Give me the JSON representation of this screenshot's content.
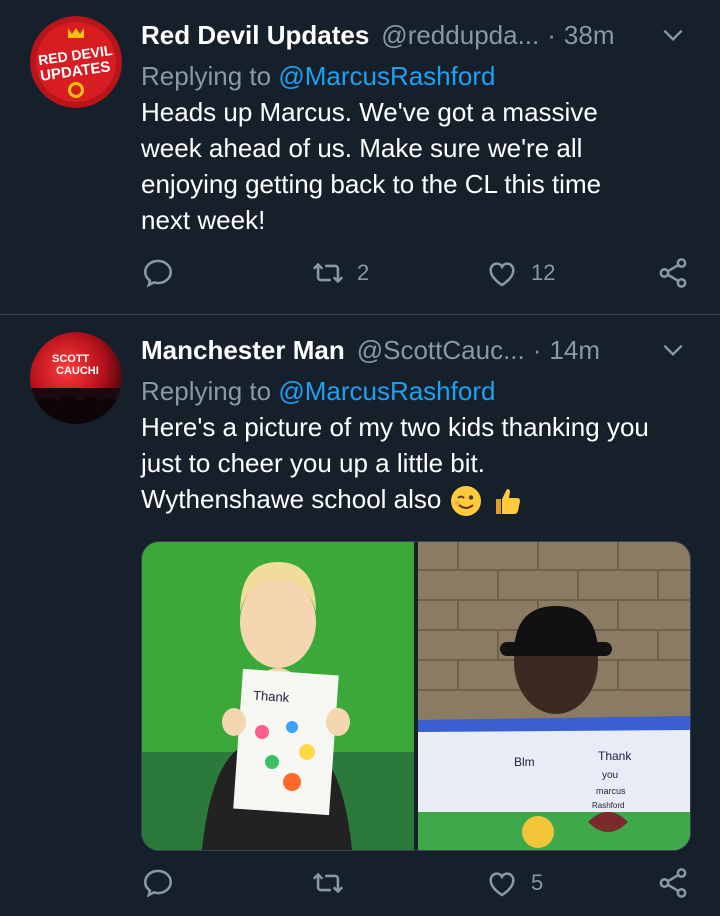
{
  "tweets": [
    {
      "author": {
        "name": "Red Devil Updates",
        "handle": "@reddupda...",
        "avatar_lines": [
          "RED DEVIL",
          "UPDATES"
        ]
      },
      "time": "38m",
      "replying_prefix": "Replying to ",
      "replying_to": "@MarcusRashford",
      "text_lines": [
        "Heads up Marcus. We've got a massive",
        "week ahead of us. Make sure we're all",
        "enjoying getting back to the CL this time",
        "next week!"
      ],
      "stats": {
        "retweets": "2",
        "likes": "12"
      }
    },
    {
      "author": {
        "name": "Manchester Man",
        "handle": "@ScottCauc...",
        "avatar_lines": [
          "SCOTT",
          "CAUCHI"
        ]
      },
      "time": "14m",
      "replying_prefix": "Replying to ",
      "replying_to": "@MarcusRashford",
      "text_lines": [
        "Here's a picture of my two kids thanking you",
        "just to cheer you up a little bit.",
        "Wythenshawe school also"
      ],
      "emojis": [
        "winking-face-emoji",
        "thumbs-up-emoji"
      ],
      "stats": {
        "likes": "5"
      },
      "photos": [
        {
          "card_text": "Thank",
          "icon": "child-holding-card"
        },
        {
          "card_text": [
            "Blm",
            "Thank",
            "you",
            "marcus",
            "Rashford"
          ],
          "icon": "child-holding-banner"
        }
      ]
    }
  ],
  "colors": {
    "background": "#15202b",
    "secondary_text": "#8899a6",
    "link": "#1da1f2",
    "divider": "#38444d"
  },
  "icons": [
    "reply-icon",
    "retweet-icon",
    "like-icon",
    "share-icon",
    "chevron-down-icon"
  ]
}
